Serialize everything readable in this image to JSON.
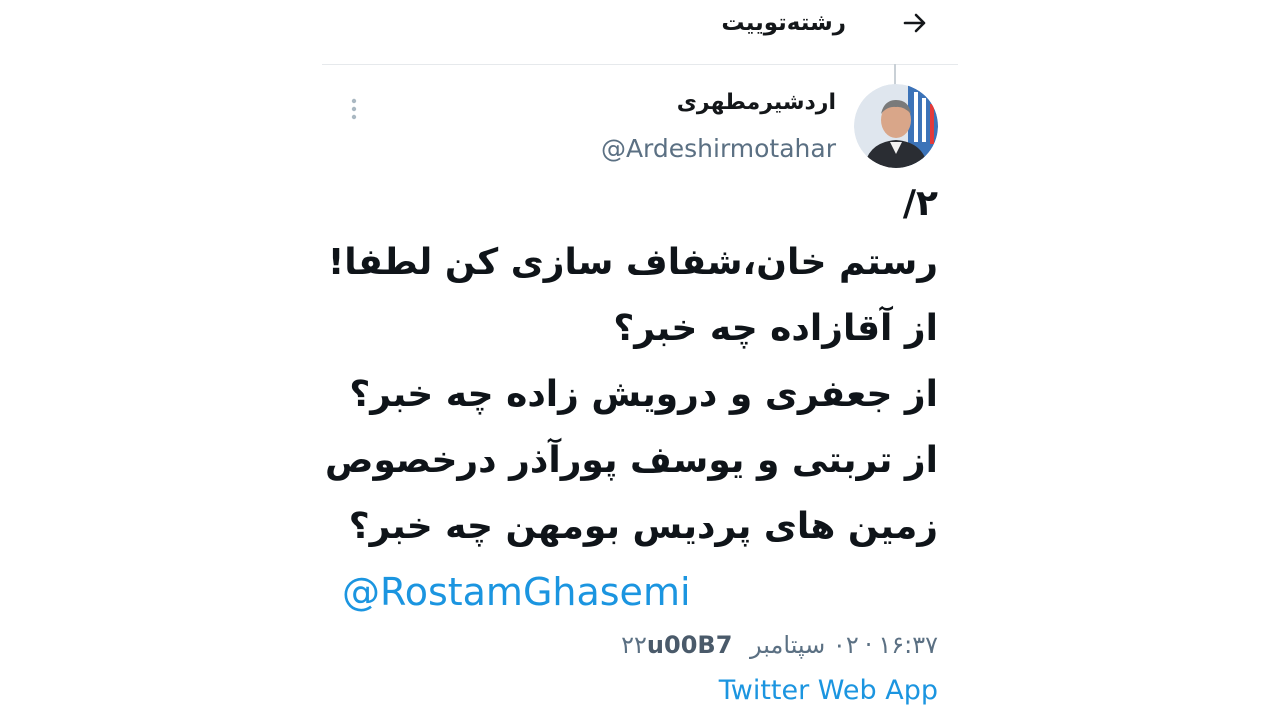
{
  "header": {
    "title": "رشته‌توییت",
    "back_icon": "arrow-right-icon"
  },
  "tweet": {
    "author_name": "اردشیرمطهری",
    "author_handle": "@Ardeshirmotahar",
    "more_icon": "more-vertical-icon",
    "lines": [
      "۲/",
      "رستم خان،شفاف سازی کن لطفا!",
      "از آقازاده چه خبر؟",
      "از جعفری و درویش زاده چه خبر؟",
      "از تربتی و یوسف پورآذر درخصوص",
      "زمین های پردیس بومهن چه خبر؟"
    ],
    "mention": "@RostamGhasemi",
    "meta": {
      "time": "۱۶:۳۷",
      "separator": "·",
      "date": "۰۲ سپتامبر ۲۲",
      "code": "u00B7"
    },
    "source": "Twitter Web App"
  },
  "colors": {
    "link": "#1b95e0",
    "text": "#0f1419",
    "muted": "#5b7083"
  }
}
